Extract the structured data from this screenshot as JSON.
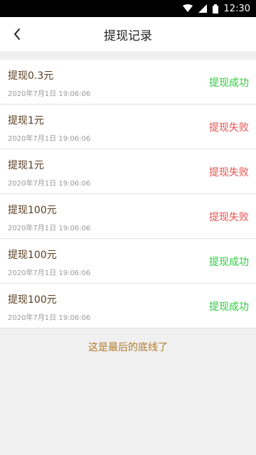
{
  "status_bar": {
    "time": "12:30"
  },
  "header": {
    "title": "提现记录"
  },
  "records": [
    {
      "title": "提现0.3元",
      "time": "2020年7月1日 19:06:06",
      "status": "提现成功",
      "status_type": "success"
    },
    {
      "title": "提现1元",
      "time": "2020年7月1日 19:06:06",
      "status": "提现失败",
      "status_type": "fail"
    },
    {
      "title": "提现1元",
      "time": "2020年7月1日 19:06:06",
      "status": "提现失败",
      "status_type": "fail"
    },
    {
      "title": "提现100元",
      "time": "2020年7月1日 19:06:06",
      "status": "提现失败",
      "status_type": "fail"
    },
    {
      "title": "提现100元",
      "time": "2020年7月1日 19:06:06",
      "status": "提现成功",
      "status_type": "success"
    },
    {
      "title": "提现100元",
      "time": "2020年7月1日 19:06:06",
      "status": "提现成功",
      "status_type": "success"
    }
  ],
  "footer_note": "这是最后的底线了",
  "colors": {
    "success": "#2ecc40",
    "fail": "#e85050",
    "footer": "#b07a2e"
  }
}
